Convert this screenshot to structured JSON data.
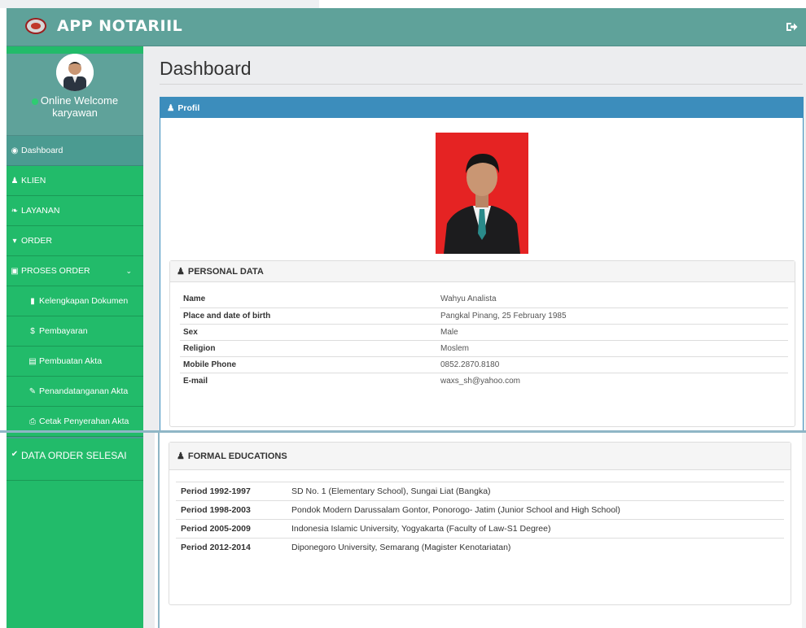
{
  "app": {
    "title": "APP NOTARIIL"
  },
  "user": {
    "welcome_line1": "Online Welcome",
    "welcome_line2": "karyawan"
  },
  "sidebar": {
    "items": [
      {
        "label": "Dashboard",
        "icon": "dashboard-icon"
      },
      {
        "label": "KLIEN",
        "icon": "user-icon"
      },
      {
        "label": "LAYANAN",
        "icon": "leaf-icon"
      },
      {
        "label": "ORDER",
        "icon": "cart-icon"
      },
      {
        "label": "PROSES ORDER",
        "icon": "circle-dot-icon"
      },
      {
        "label": "Kelengkapan Dokumen",
        "icon": "folder-icon"
      },
      {
        "label": "Pembayaran",
        "icon": "dollar-icon"
      },
      {
        "label": "Pembuatan Akta",
        "icon": "list-icon"
      },
      {
        "label": "Penandatanganan Akta",
        "icon": "pencil-icon"
      },
      {
        "label": "Cetak Penyerahan Akta",
        "icon": "print-icon"
      },
      {
        "label": "DATA ORDER SELESAI",
        "icon": "check-icon"
      }
    ]
  },
  "main": {
    "page_title": "Dashboard",
    "profil_label": "Profil",
    "personal": {
      "heading": "PERSONAL DATA",
      "rows": [
        {
          "k": "Name",
          "v": "Wahyu Analista"
        },
        {
          "k": "Place and date of birth",
          "v": "Pangkal Pinang, 25 February 1985"
        },
        {
          "k": "Sex",
          "v": "Male"
        },
        {
          "k": "Religion",
          "v": "Moslem"
        },
        {
          "k": "Mobile Phone",
          "v": "0852.2870.8180"
        },
        {
          "k": "E-mail",
          "v": "waxs_sh@yahoo.com"
        }
      ]
    },
    "education": {
      "heading": "FORMAL EDUCATIONS",
      "rows": [
        {
          "k": "Period 1992-1997",
          "v": "SD No. 1 (Elementary School), Sungai Liat (Bangka)"
        },
        {
          "k": "Period 1998-2003",
          "v": "Pondok Modern Darussalam Gontor, Ponorogo- Jatim (Junior School and High School)"
        },
        {
          "k": "Period 2005-2009",
          "v": "Indonesia Islamic University, Yogyakarta (Faculty of Law-S1 Degree)"
        },
        {
          "k": "Period 2012-2014",
          "v": "Diponegoro University, Semarang (Magister Kenotariatan)"
        }
      ]
    }
  },
  "colors": {
    "header": "#5fa29a",
    "sidebar": "#22bb6a",
    "panel_accent": "#3c8dbc",
    "photo_bg": "#e52323"
  }
}
